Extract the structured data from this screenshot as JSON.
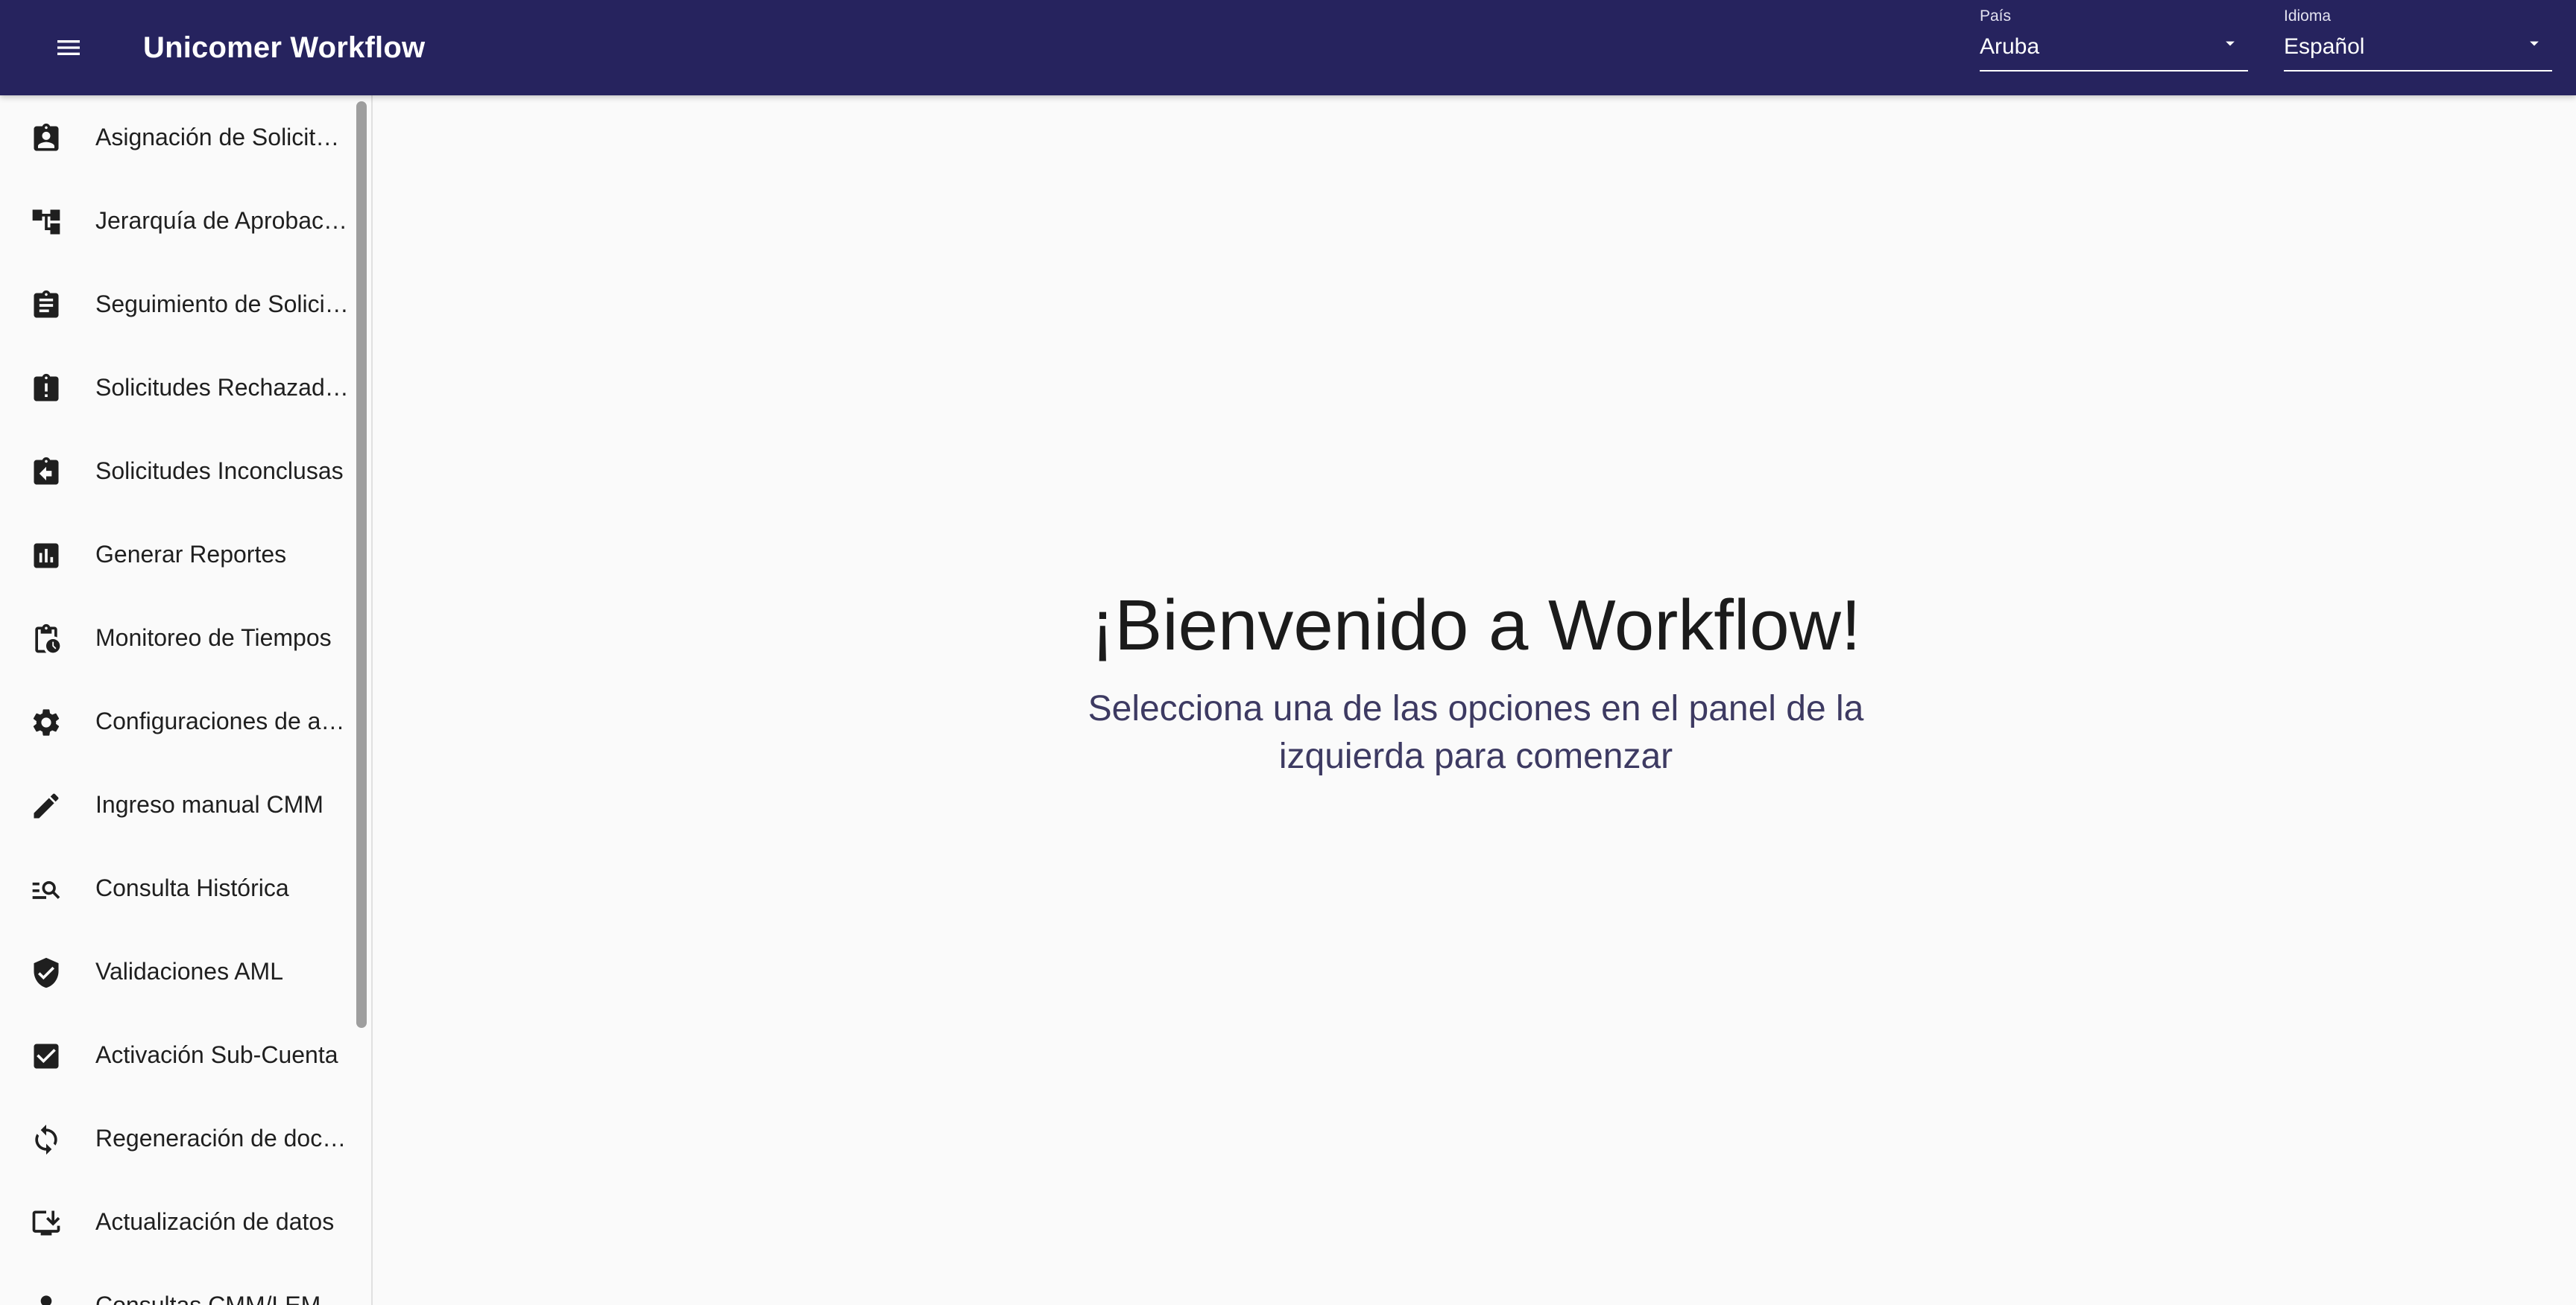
{
  "app": {
    "title": "Unicomer Workflow"
  },
  "header": {
    "menu_icon": "menu-icon",
    "country": {
      "label": "País",
      "value": "Aruba"
    },
    "language": {
      "label": "Idioma",
      "value": "Español"
    }
  },
  "sidebar": {
    "items": [
      {
        "label": "Asignación de Solicitudes",
        "icon": "assignment-ind-icon"
      },
      {
        "label": "Jerarquía de Aprobación",
        "icon": "account-tree-icon"
      },
      {
        "label": "Seguimiento de Solicitudes",
        "icon": "assignment-icon"
      },
      {
        "label": "Solicitudes Rechazadas",
        "icon": "assignment-late-icon"
      },
      {
        "label": "Solicitudes Inconclusas",
        "icon": "assignment-return-icon"
      },
      {
        "label": "Generar Reportes",
        "icon": "assessment-icon"
      },
      {
        "label": "Monitoreo de Tiempos",
        "icon": "pending-actions-icon"
      },
      {
        "label": "Configuraciones de asignación",
        "icon": "settings-icon"
      },
      {
        "label": "Ingreso manual CMM",
        "icon": "edit-icon"
      },
      {
        "label": "Consulta Histórica",
        "icon": "manage-search-icon"
      },
      {
        "label": "Validaciones AML",
        "icon": "verified-user-icon"
      },
      {
        "label": "Activación Sub-Cuenta",
        "icon": "check-box-icon"
      },
      {
        "label": "Regeneración de documentos",
        "icon": "sync-icon"
      },
      {
        "label": "Actualización de datos",
        "icon": "download-desktop-icon"
      },
      {
        "label": "Consultas CMM/LEM",
        "icon": "person-icon"
      }
    ]
  },
  "main": {
    "title": "¡Bienvenido a Workflow!",
    "subtitle": "Selecciona una de las opciones en el panel de la izquierda para comenzar"
  },
  "colors": {
    "appbar": "#26235e",
    "subtitle": "#3d3a62",
    "background": "#fafafa"
  }
}
